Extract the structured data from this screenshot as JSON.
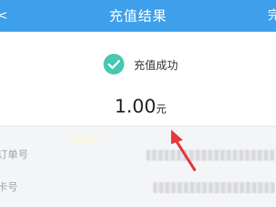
{
  "header": {
    "back_label": "<",
    "title": "充值结果",
    "done_label": "完"
  },
  "result": {
    "status_text": "充值成功",
    "amount": "1.00",
    "unit": "元",
    "check_color": "#45c9b0"
  },
  "details": {
    "order_no_label": "订单号",
    "card_no_label": "卡号"
  },
  "colors": {
    "header_bg": "#3ea0ea",
    "annotation_arrow": "#e23b3b"
  }
}
